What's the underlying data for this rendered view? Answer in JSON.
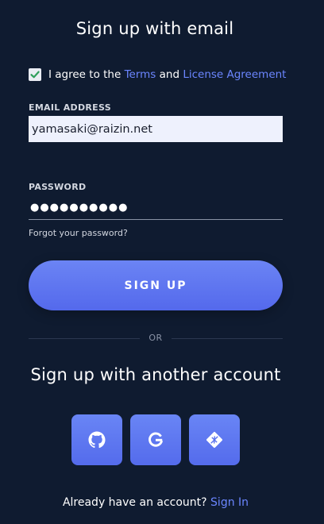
{
  "title": "Sign up with email",
  "agreement": {
    "checked": true,
    "prefix": "I agree to the ",
    "terms_link": "Terms",
    "conjunction": " and ",
    "license_link": "License Agreement"
  },
  "email": {
    "label": "EMAIL ADDRESS",
    "value": "yamasaki@raizin.net"
  },
  "password": {
    "label": "PASSWORD",
    "masked_value": "●●●●●●●●●●"
  },
  "forgot_password": "Forgot your password?",
  "signup_button": "SIGN UP",
  "divider_text": "OR",
  "social": {
    "heading": "Sign up with another account",
    "providers": [
      {
        "name": "github",
        "icon": "github-icon"
      },
      {
        "name": "google",
        "icon": "google-icon"
      },
      {
        "name": "netlify",
        "icon": "netlify-icon"
      }
    ]
  },
  "footer": {
    "text": "Already have an account? ",
    "signin_link": "Sign In"
  },
  "colors": {
    "background": "#0f1b30",
    "accent": "#5a72ee",
    "link": "#6b86ff",
    "checkbox_tick": "#2e9e5b"
  }
}
